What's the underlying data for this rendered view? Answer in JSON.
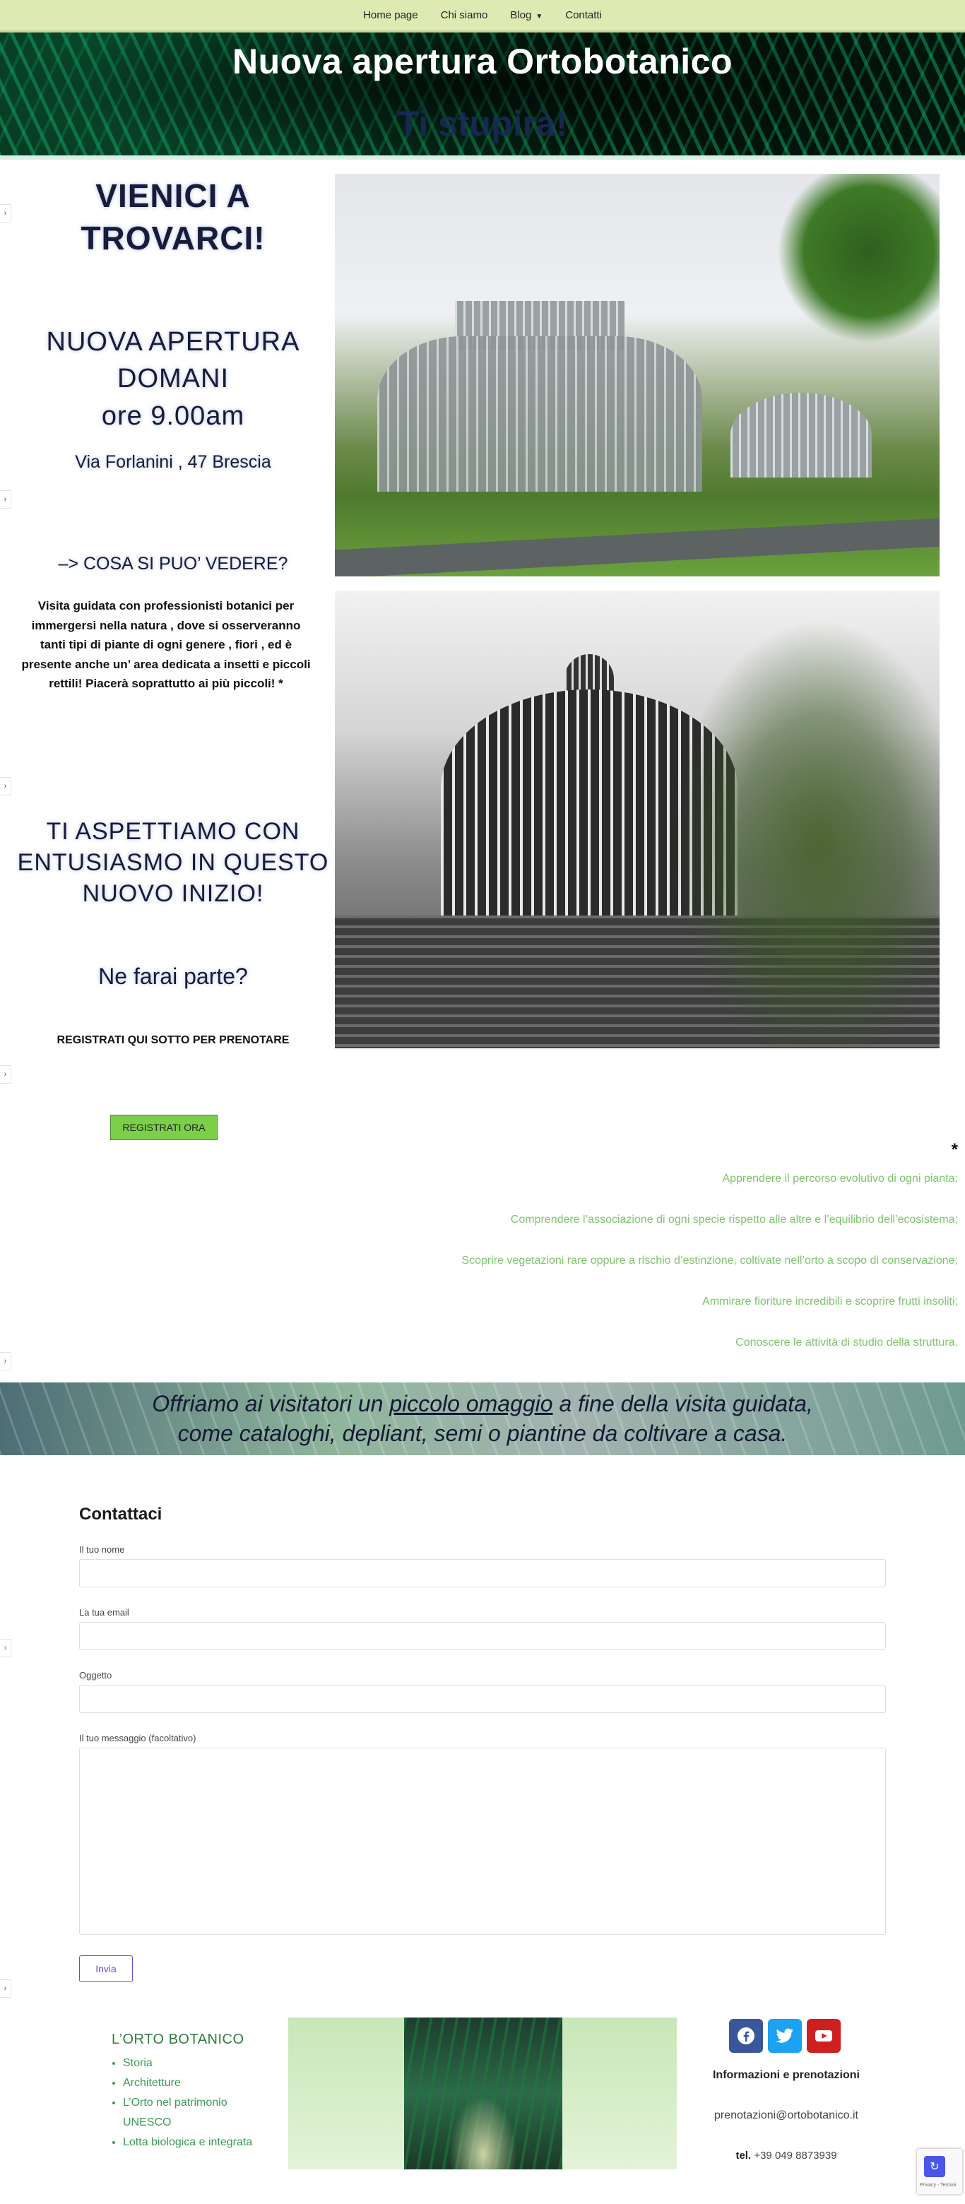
{
  "nav": {
    "items": [
      "Home page",
      "Chi siamo",
      "Blog",
      "Contatti"
    ]
  },
  "hero": {
    "title": "Nuova apertura Ortobotanico",
    "subtitle": "Ti stupirà!"
  },
  "left": {
    "title": "VIENICI A TROVARCI!",
    "opening_line1": "NUOVA APERTURA DOMANI",
    "opening_line2": "ore 9.00am",
    "address": "Via Forlanini , 47 Brescia",
    "question": "–> COSA SI PUO’ VEDERE?",
    "paragraph": "Visita guidata con professionisti botanici per immergersi nella natura , dove si osserveranno tanti tipi di piante di ogni genere , fiori , ed è presente anche un’ area dedicata a insetti e piccoli rettili! Piacerà soprattutto ai più piccoli! *",
    "await": "TI ASPETTIAMO CON ENTUSIASMO IN QUESTO NUOVO INIZIO!",
    "ask": "Ne farai parte?",
    "register_note": "REGISTRATI QUI SOTTO PER PRENOTARE"
  },
  "register_button": "REGISTRATI ORA",
  "asterisk": "*",
  "features": [
    "Apprendere il percorso evolutivo di ogni pianta;",
    "Comprendere l’associazione di ogni specie rispetto alle altre e l’equilibrio dell’ecosistema;",
    "Scoprire vegetazioni rare oppure a rischio d’estinzione, coltivate nell’orto a scopo di conservazione;",
    "Ammirare fioriture incredibili e scoprire frutti insoliti;",
    "Conoscere le attività di studio della struttura."
  ],
  "gift": {
    "before": "Offriamo ai visitatori un ",
    "link": "piccolo omaggio",
    "after": " a fine della visita guidata,",
    "line2": "come cataloghi, depliant, semi o piantine da coltivare a casa."
  },
  "form": {
    "title": "Contattaci",
    "name_label": "Il tuo nome",
    "email_label": "La tua email",
    "subject_label": "Oggetto",
    "message_label": "Il tuo messaggio (facoltativo)",
    "submit": "Invia"
  },
  "footer": {
    "title": "L’ORTO BOTANICO",
    "links": [
      "Storia",
      "Architetture",
      "L’Orto nel patrimonio UNESCO",
      "Lotta biologica e integrata"
    ],
    "info_title": "Informazioni e prenotazioni",
    "email": "prenotazioni@ortobotanico.it",
    "tel_label": "tel.",
    "tel": "+39 049 8873939",
    "social": [
      {
        "name": "facebook-icon",
        "color": "#3a579b"
      },
      {
        "name": "twitter-icon",
        "color": "#1da1f2"
      },
      {
        "name": "youtube-icon",
        "color": "#cd201f"
      }
    ]
  },
  "recaptcha_text": "Privacy - Termini"
}
